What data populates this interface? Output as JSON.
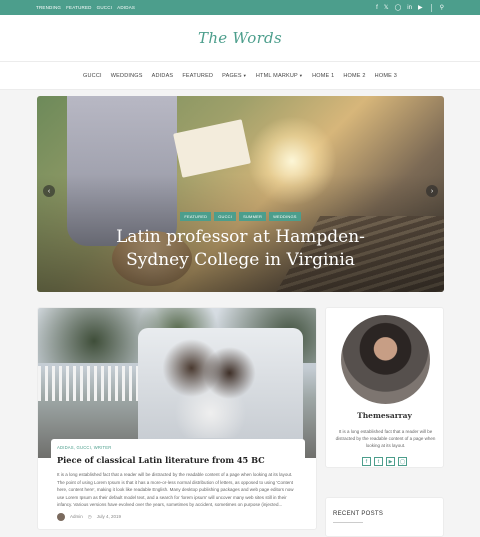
{
  "topbar": {
    "links": [
      "TRENDING",
      "FEATURED",
      "GUCCI",
      "ADIDAS"
    ],
    "social_icons": [
      "facebook-icon",
      "twitter-icon",
      "instagram-icon",
      "linkedin-icon",
      "youtube-icon"
    ],
    "search_icon": "search-icon"
  },
  "header": {
    "logo": "The Words"
  },
  "nav": {
    "items": [
      "GUCCI",
      "WEDDINGS",
      "ADIDAS",
      "FEATURED",
      "PAGES",
      "HTML MARKUP",
      "HOME 1",
      "HOME 2",
      "HOME 3"
    ]
  },
  "hero": {
    "tags": [
      "FEATURED",
      "GUCCI",
      "SUMMER",
      "WEDDINGS"
    ],
    "title_line1": "Latin professor at Hampden-",
    "title_line2": "Sydney College in Virginia"
  },
  "post": {
    "categories": "ADIDAS, GUCCI, WRITER",
    "title": "Piece of classical Latin literature from 45 BC",
    "excerpt": "It is a long established fact that a reader will be distracted by the readable content of a page when looking at its layout. The point of using Lorem Ipsum is that it has a more-or-less normal distribution of letters, as opposed to using 'Content here, content here', making it look like readable English. Many desktop publishing packages and web page editors now use Lorem Ipsum as their default model text, and a search for 'lorem ipsum' will uncover many web sites still in their infancy. Various versions have evolved over the years, sometimes by accident, sometimes on purpose (injected...",
    "author": "Admin",
    "date": "July 4, 2019"
  },
  "sidebar": {
    "name": "Themesarray",
    "bio": "It is a long established fact that a reader will be distracted by the readable content of a page when looking at its layout.",
    "social_icons": [
      "facebook-icon",
      "twitter-icon",
      "youtube-icon",
      "instagram-icon"
    ]
  },
  "recent": {
    "heading": "RECENT POSTS"
  },
  "colors": {
    "accent": "#4c9e8c"
  }
}
